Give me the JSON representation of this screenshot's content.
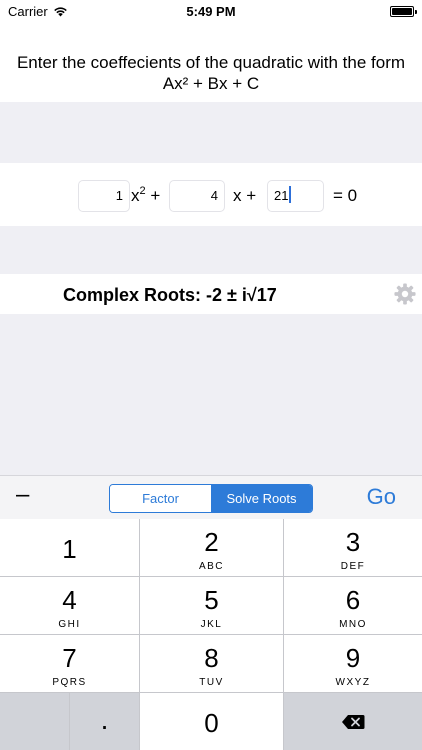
{
  "status_bar": {
    "carrier": "Carrier",
    "time": "5:49 PM"
  },
  "header": {
    "line1": "Enter the coeffecients of the quadratic with the form",
    "line2": "Ax² + Bx + C"
  },
  "equation": {
    "a_value": "1",
    "b_value": "4",
    "c_value": "21",
    "x_squared": "x",
    "squared_exp": "2",
    "plus1": "+",
    "x_term": "x +",
    "equals": "= 0"
  },
  "result": {
    "text": "Complex Roots: -2 ± i√17"
  },
  "toolbar": {
    "minus_label": "–",
    "segments": [
      "Factor",
      "Solve Roots"
    ],
    "selected_segment": "Solve Roots",
    "go_label": "Go"
  },
  "keypad": {
    "keys": [
      {
        "num": "1",
        "letters": ""
      },
      {
        "num": "2",
        "letters": "ABC"
      },
      {
        "num": "3",
        "letters": "DEF"
      },
      {
        "num": "4",
        "letters": "GHI"
      },
      {
        "num": "5",
        "letters": "JKL"
      },
      {
        "num": "6",
        "letters": "MNO"
      },
      {
        "num": "7",
        "letters": "PQRS"
      },
      {
        "num": "8",
        "letters": "TUV"
      },
      {
        "num": "9",
        "letters": "WXYZ"
      },
      {
        "num": "",
        "letters": ""
      },
      {
        "num": ".",
        "letters": ""
      },
      {
        "num": "0",
        "letters": ""
      }
    ]
  },
  "icons": {
    "wifi": "wifi-icon",
    "battery": "battery-icon",
    "gear": "gear-icon",
    "delete": "backspace-icon"
  },
  "colors": {
    "accent": "#2d7bd8",
    "background": "#efeff4",
    "caret": "#2d6fd9"
  }
}
